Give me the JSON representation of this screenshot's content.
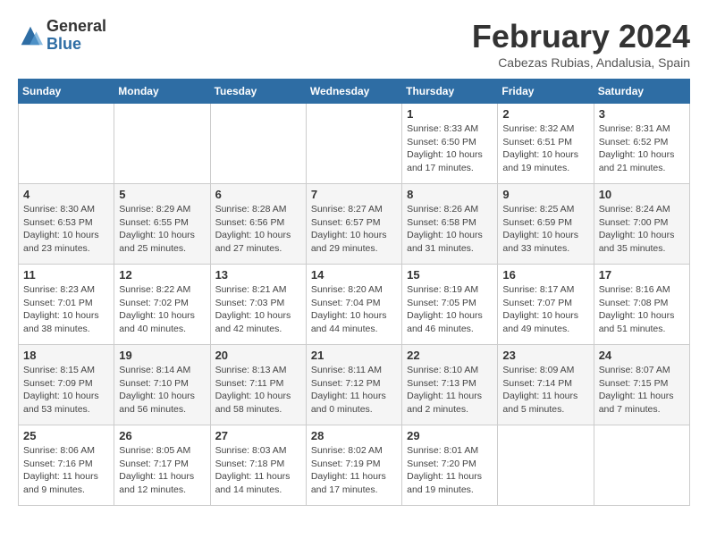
{
  "logo": {
    "line1": "General",
    "line2": "Blue"
  },
  "title": "February 2024",
  "subtitle": "Cabezas Rubias, Andalusia, Spain",
  "weekdays": [
    "Sunday",
    "Monday",
    "Tuesday",
    "Wednesday",
    "Thursday",
    "Friday",
    "Saturday"
  ],
  "weeks": [
    [
      {
        "day": "",
        "info": ""
      },
      {
        "day": "",
        "info": ""
      },
      {
        "day": "",
        "info": ""
      },
      {
        "day": "",
        "info": ""
      },
      {
        "day": "1",
        "info": "Sunrise: 8:33 AM\nSunset: 6:50 PM\nDaylight: 10 hours\nand 17 minutes."
      },
      {
        "day": "2",
        "info": "Sunrise: 8:32 AM\nSunset: 6:51 PM\nDaylight: 10 hours\nand 19 minutes."
      },
      {
        "day": "3",
        "info": "Sunrise: 8:31 AM\nSunset: 6:52 PM\nDaylight: 10 hours\nand 21 minutes."
      }
    ],
    [
      {
        "day": "4",
        "info": "Sunrise: 8:30 AM\nSunset: 6:53 PM\nDaylight: 10 hours\nand 23 minutes."
      },
      {
        "day": "5",
        "info": "Sunrise: 8:29 AM\nSunset: 6:55 PM\nDaylight: 10 hours\nand 25 minutes."
      },
      {
        "day": "6",
        "info": "Sunrise: 8:28 AM\nSunset: 6:56 PM\nDaylight: 10 hours\nand 27 minutes."
      },
      {
        "day": "7",
        "info": "Sunrise: 8:27 AM\nSunset: 6:57 PM\nDaylight: 10 hours\nand 29 minutes."
      },
      {
        "day": "8",
        "info": "Sunrise: 8:26 AM\nSunset: 6:58 PM\nDaylight: 10 hours\nand 31 minutes."
      },
      {
        "day": "9",
        "info": "Sunrise: 8:25 AM\nSunset: 6:59 PM\nDaylight: 10 hours\nand 33 minutes."
      },
      {
        "day": "10",
        "info": "Sunrise: 8:24 AM\nSunset: 7:00 PM\nDaylight: 10 hours\nand 35 minutes."
      }
    ],
    [
      {
        "day": "11",
        "info": "Sunrise: 8:23 AM\nSunset: 7:01 PM\nDaylight: 10 hours\nand 38 minutes."
      },
      {
        "day": "12",
        "info": "Sunrise: 8:22 AM\nSunset: 7:02 PM\nDaylight: 10 hours\nand 40 minutes."
      },
      {
        "day": "13",
        "info": "Sunrise: 8:21 AM\nSunset: 7:03 PM\nDaylight: 10 hours\nand 42 minutes."
      },
      {
        "day": "14",
        "info": "Sunrise: 8:20 AM\nSunset: 7:04 PM\nDaylight: 10 hours\nand 44 minutes."
      },
      {
        "day": "15",
        "info": "Sunrise: 8:19 AM\nSunset: 7:05 PM\nDaylight: 10 hours\nand 46 minutes."
      },
      {
        "day": "16",
        "info": "Sunrise: 8:17 AM\nSunset: 7:07 PM\nDaylight: 10 hours\nand 49 minutes."
      },
      {
        "day": "17",
        "info": "Sunrise: 8:16 AM\nSunset: 7:08 PM\nDaylight: 10 hours\nand 51 minutes."
      }
    ],
    [
      {
        "day": "18",
        "info": "Sunrise: 8:15 AM\nSunset: 7:09 PM\nDaylight: 10 hours\nand 53 minutes."
      },
      {
        "day": "19",
        "info": "Sunrise: 8:14 AM\nSunset: 7:10 PM\nDaylight: 10 hours\nand 56 minutes."
      },
      {
        "day": "20",
        "info": "Sunrise: 8:13 AM\nSunset: 7:11 PM\nDaylight: 10 hours\nand 58 minutes."
      },
      {
        "day": "21",
        "info": "Sunrise: 8:11 AM\nSunset: 7:12 PM\nDaylight: 11 hours\nand 0 minutes."
      },
      {
        "day": "22",
        "info": "Sunrise: 8:10 AM\nSunset: 7:13 PM\nDaylight: 11 hours\nand 2 minutes."
      },
      {
        "day": "23",
        "info": "Sunrise: 8:09 AM\nSunset: 7:14 PM\nDaylight: 11 hours\nand 5 minutes."
      },
      {
        "day": "24",
        "info": "Sunrise: 8:07 AM\nSunset: 7:15 PM\nDaylight: 11 hours\nand 7 minutes."
      }
    ],
    [
      {
        "day": "25",
        "info": "Sunrise: 8:06 AM\nSunset: 7:16 PM\nDaylight: 11 hours\nand 9 minutes."
      },
      {
        "day": "26",
        "info": "Sunrise: 8:05 AM\nSunset: 7:17 PM\nDaylight: 11 hours\nand 12 minutes."
      },
      {
        "day": "27",
        "info": "Sunrise: 8:03 AM\nSunset: 7:18 PM\nDaylight: 11 hours\nand 14 minutes."
      },
      {
        "day": "28",
        "info": "Sunrise: 8:02 AM\nSunset: 7:19 PM\nDaylight: 11 hours\nand 17 minutes."
      },
      {
        "day": "29",
        "info": "Sunrise: 8:01 AM\nSunset: 7:20 PM\nDaylight: 11 hours\nand 19 minutes."
      },
      {
        "day": "",
        "info": ""
      },
      {
        "day": "",
        "info": ""
      }
    ]
  ]
}
